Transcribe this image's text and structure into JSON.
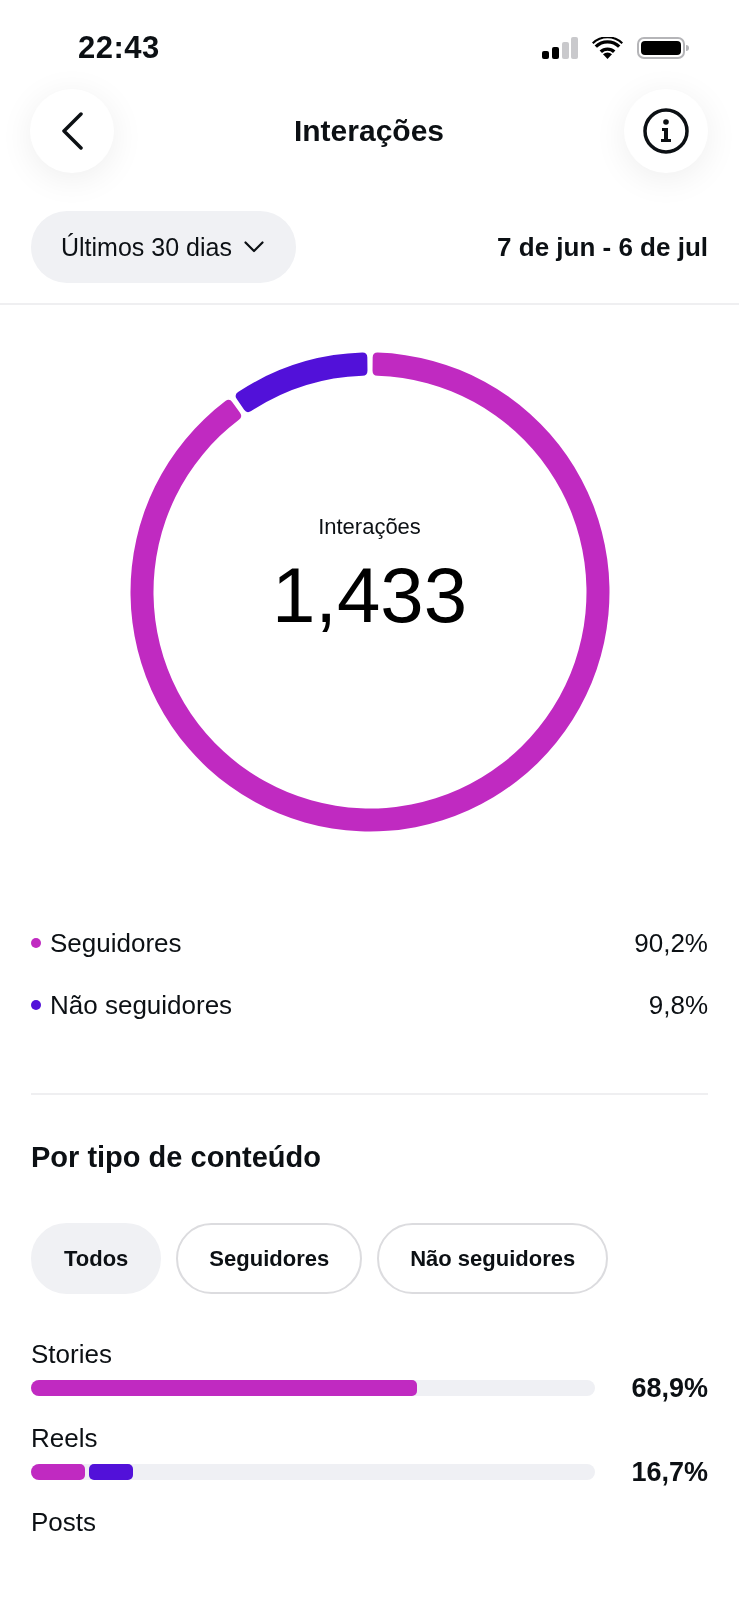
{
  "status_bar": {
    "time": "22:43"
  },
  "header": {
    "title": "Interações"
  },
  "period": {
    "dropdown": "Últimos 30 dias",
    "range": "7 de jun - 6 de jul"
  },
  "donut": {
    "label": "Interações",
    "total": "1,433",
    "chart_data": {
      "type": "donut",
      "categories": [
        "Seguidores",
        "Não seguidores"
      ],
      "values": [
        90.2,
        9.8
      ]
    }
  },
  "legend": [
    {
      "value": "90,2%",
      "color": "#c02ac1"
    },
    {
      "value": "9,8%",
      "color": "#5211d9"
    }
  ],
  "content_section": {
    "title": "Por tipo de conteúdo",
    "filters": [
      {
        "label": "Todos",
        "selected": true
      },
      {
        "label": "Seguidores",
        "selected": false
      },
      {
        "label": "Não seguidores",
        "selected": false
      }
    ],
    "rows": [
      {
        "label": "Stories",
        "value": "68,9%",
        "segments": [
          {
            "level": 0.684,
            "color": "#c02ac1"
          }
        ]
      },
      {
        "label": "Reels",
        "value": "16,7%",
        "segments": [
          {
            "level": 0.095,
            "color": "#c02ac1"
          },
          {
            "level": 0.078,
            "color": "#5211d9"
          }
        ]
      },
      {
        "label": "Posts"
      }
    ]
  }
}
